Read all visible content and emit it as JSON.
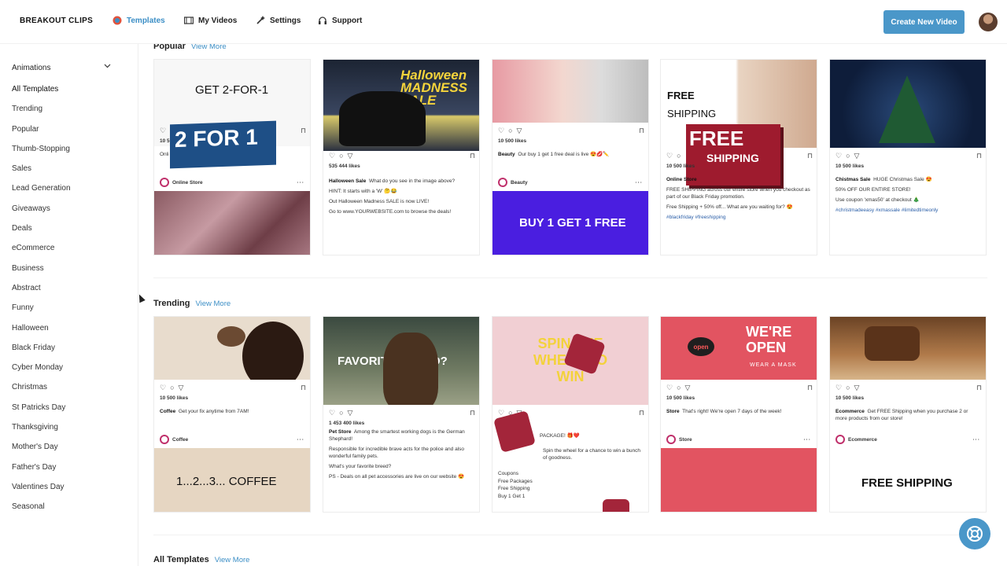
{
  "app": {
    "logo": "BREAKOUT CLIPS"
  },
  "nav": [
    {
      "label": "Templates",
      "icon": "templates-icon",
      "active": true
    },
    {
      "label": "My Videos",
      "icon": "film-icon"
    },
    {
      "label": "Settings",
      "icon": "wand-icon"
    },
    {
      "label": "Support",
      "icon": "headset-icon"
    }
  ],
  "header": {
    "create_label": "Create New Video"
  },
  "sidebar": {
    "group_label": "Animations",
    "items": [
      "All Templates",
      "Trending",
      "Popular",
      "Thumb-Stopping",
      "Sales",
      "Lead Generation",
      "Giveaways",
      "Deals",
      "eCommerce",
      "Business",
      "Abstract",
      "Funny",
      "Halloween",
      "Black Friday",
      "Cyber Monday",
      "Christmas",
      "St Patricks Day",
      "Thanksgiving",
      "Mother's Day",
      "Father's Day",
      "Valentines Day",
      "Seasonal"
    ]
  },
  "sections": {
    "popular": {
      "title": "Popular",
      "view_more": "View More"
    },
    "trending": {
      "title": "Trending",
      "view_more": "View More"
    },
    "all": {
      "title": "All Templates",
      "view_more": "View More"
    }
  },
  "popular_cards": [
    {
      "headline": "GET 2-FOR-1",
      "banner": "2 FOR 1",
      "likes": "10 5",
      "author": "Online Store",
      "extra": "Onli"
    },
    {
      "headline": "Halloween MADNESS SALE",
      "likes": "535 444 likes",
      "author": "Halloween Sale",
      "caption": "What do you see in the image above?",
      "lines": [
        "HINT: It starts with a 'W' 🤔😂",
        "Out Halloween Madness SALE is now LIVE!",
        "Go to www.YOURWEBSITE.com to browse the deals!"
      ]
    },
    {
      "likes": "10 500 likes",
      "author": "Beauty",
      "caption": "Our buy 1 get 1 free deal is live 😍💋✏️",
      "banner": "BUY 1 GET 1 FREE"
    },
    {
      "headline_1": "FREE",
      "headline_2": "SHIPPING",
      "banner_1": "FREE",
      "banner_2": "SHIPPING",
      "likes": "10 500 likes",
      "author": "Online Store",
      "lines": [
        "FREE SHIPPING across our entire store when you checkout as part of our Black Friday promotion.",
        "Free Shipping + 50% off... What are you waiting for? 😍",
        "#blackfriday #freeshipping"
      ]
    },
    {
      "likes": "10 500 likes",
      "author": "Chistmas Sale",
      "caption": "HUGE Christmas Sale 😍",
      "lines": [
        "50% OFF OUR ENTIRE STORE!",
        "Use coupon 'xmas50' at checkout 🎄",
        "#christmadeeasy #xmassale #limitedtimeonly"
      ]
    }
  ],
  "trending_cards": [
    {
      "likes": "10 500 likes",
      "author": "Coffee",
      "caption": "Get your fix anytime from 7AM!",
      "footer": "1...2...3... COFFEE"
    },
    {
      "headline": "FAVORITE BREED?",
      "likes": "1 453 400 likes",
      "author": "Pet Store",
      "caption": "Among the smartest working dogs is the German Shephard!",
      "lines": [
        "Responsible for incredible brave acts for the police and also wonderful family pets.",
        "What's your favorite breed?",
        "PS - Deals on all pet accessories are live on our website 😍"
      ]
    },
    {
      "headline": "SPIN THE WHEEL TO WIN",
      "likes": "10 500 likes",
      "author": "Store",
      "caption": "PACKAGE! 🎁❤️",
      "lines": [
        "Spin the wheel for a chance to win a bunch of goodness.",
        "Coupons",
        "Free Packages",
        "Free Shipping",
        "Buy 1 Get 1"
      ]
    },
    {
      "headline_1": "WE'RE",
      "headline_2": "OPEN",
      "sub": "WEAR A MASK",
      "sign": "open",
      "likes": "10 500 likes",
      "author": "Store",
      "caption": "That's right! We're open 7 days of the week!"
    },
    {
      "likes": "10 500 likes",
      "author": "Ecommerce",
      "caption": "Get FREE Shipping when you purchase 2 or more products from our store!",
      "footer": "FREE SHIPPING"
    }
  ],
  "colors": {
    "accent": "#4a97c9",
    "instagram": "#c0306b",
    "purple": "#4a1ee0",
    "red": "#e25461",
    "crimson": "#9e1b2e"
  }
}
